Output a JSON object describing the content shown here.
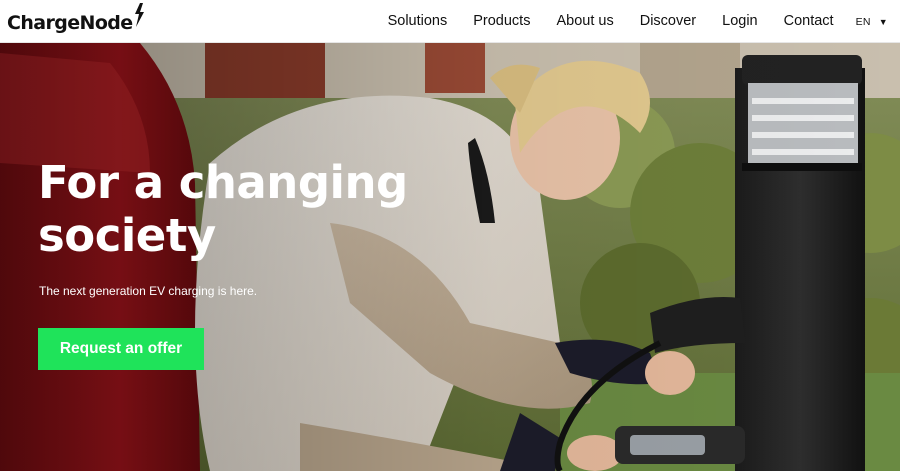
{
  "header": {
    "logo_text": "ChargeNode",
    "nav": [
      {
        "label": "Solutions"
      },
      {
        "label": "Products"
      },
      {
        "label": "About us"
      },
      {
        "label": "Discover"
      },
      {
        "label": "Login"
      },
      {
        "label": "Contact"
      }
    ],
    "language": {
      "label": "EN",
      "caret_icon": "chevron-down-icon"
    }
  },
  "hero": {
    "title": "For a changing society",
    "subtitle": "The next generation EV charging is here.",
    "cta_label": "Request an offer",
    "image_description_icon": "photo-woman-charging-ev"
  },
  "colors": {
    "cta_background": "#1fe35a",
    "text_primary": "#111111",
    "hero_text": "#ffffff"
  }
}
